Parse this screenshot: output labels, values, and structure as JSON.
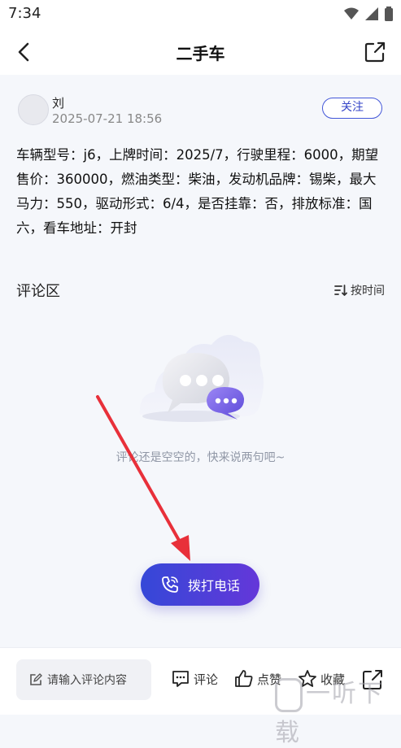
{
  "status": {
    "time": "7:34"
  },
  "nav": {
    "title": "二手车"
  },
  "post": {
    "author": "刘",
    "date": "2025-07-21 18:56",
    "follow_label": "关注",
    "content": "车辆型号：j6，上牌时间：2025/7，行驶里程：6000，期望售价：360000，燃油类型：柴油，发动机品牌：锡柴，最大马力：550，驱动形式：6/4，是否挂靠：否，排放标准：国六，看车地址：开封"
  },
  "comments": {
    "title": "评论区",
    "sort_label": "按时间",
    "empty_text": "评论还是空空的，快来说两句吧~"
  },
  "call_button": {
    "label": "拨打电话"
  },
  "bottom": {
    "input_placeholder": "请输入评论内容",
    "comment_label": "评论",
    "like_label": "点赞",
    "favorite_label": "收藏"
  },
  "watermark": {
    "text": "一听下载"
  },
  "colors": {
    "accent": "#3545c8",
    "button_start": "#3548d8",
    "button_end": "#6437d9",
    "arrow": "#e8303a"
  }
}
